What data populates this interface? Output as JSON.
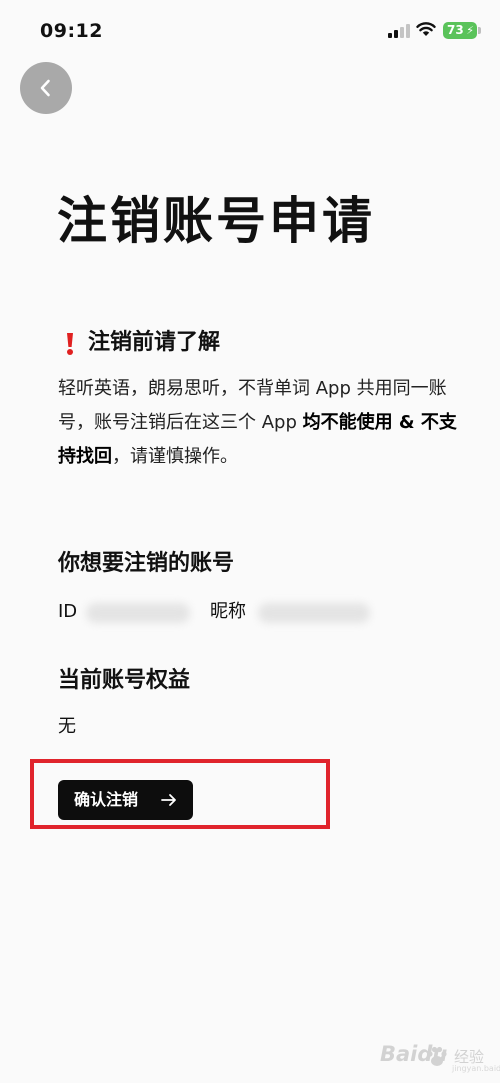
{
  "status_bar": {
    "time": "09:12",
    "battery": "73"
  },
  "header": {
    "title": "注销账号申请"
  },
  "notice": {
    "title": "注销前请了解",
    "body_part1": "轻听英语，朗易思听，不背单词 App 共用同一账号，账号注销后在这三个 App ",
    "body_bold1": "均不能使用",
    "body_amp": " & ",
    "body_bold2": "不支持找回",
    "body_part2": "，请谨慎操作。"
  },
  "account": {
    "heading": "你想要注销的账号",
    "id_label": "ID",
    "nickname_label": "昵称"
  },
  "benefits": {
    "heading": "当前账号权益",
    "value": "无"
  },
  "actions": {
    "confirm_label": "确认注销"
  },
  "watermark": {
    "logo": "Baidu",
    "text": "经验",
    "sub": "jingyan.baidu.com"
  },
  "colors": {
    "highlight": "#e0242c",
    "button": "#0d0d0d",
    "battery": "#5ac35a",
    "exclaim": "#e02020"
  },
  "icons": [
    "back-icon",
    "signal-icon",
    "wifi-icon",
    "battery-icon",
    "exclamation-icon",
    "arrow-right-icon",
    "paw-icon"
  ]
}
